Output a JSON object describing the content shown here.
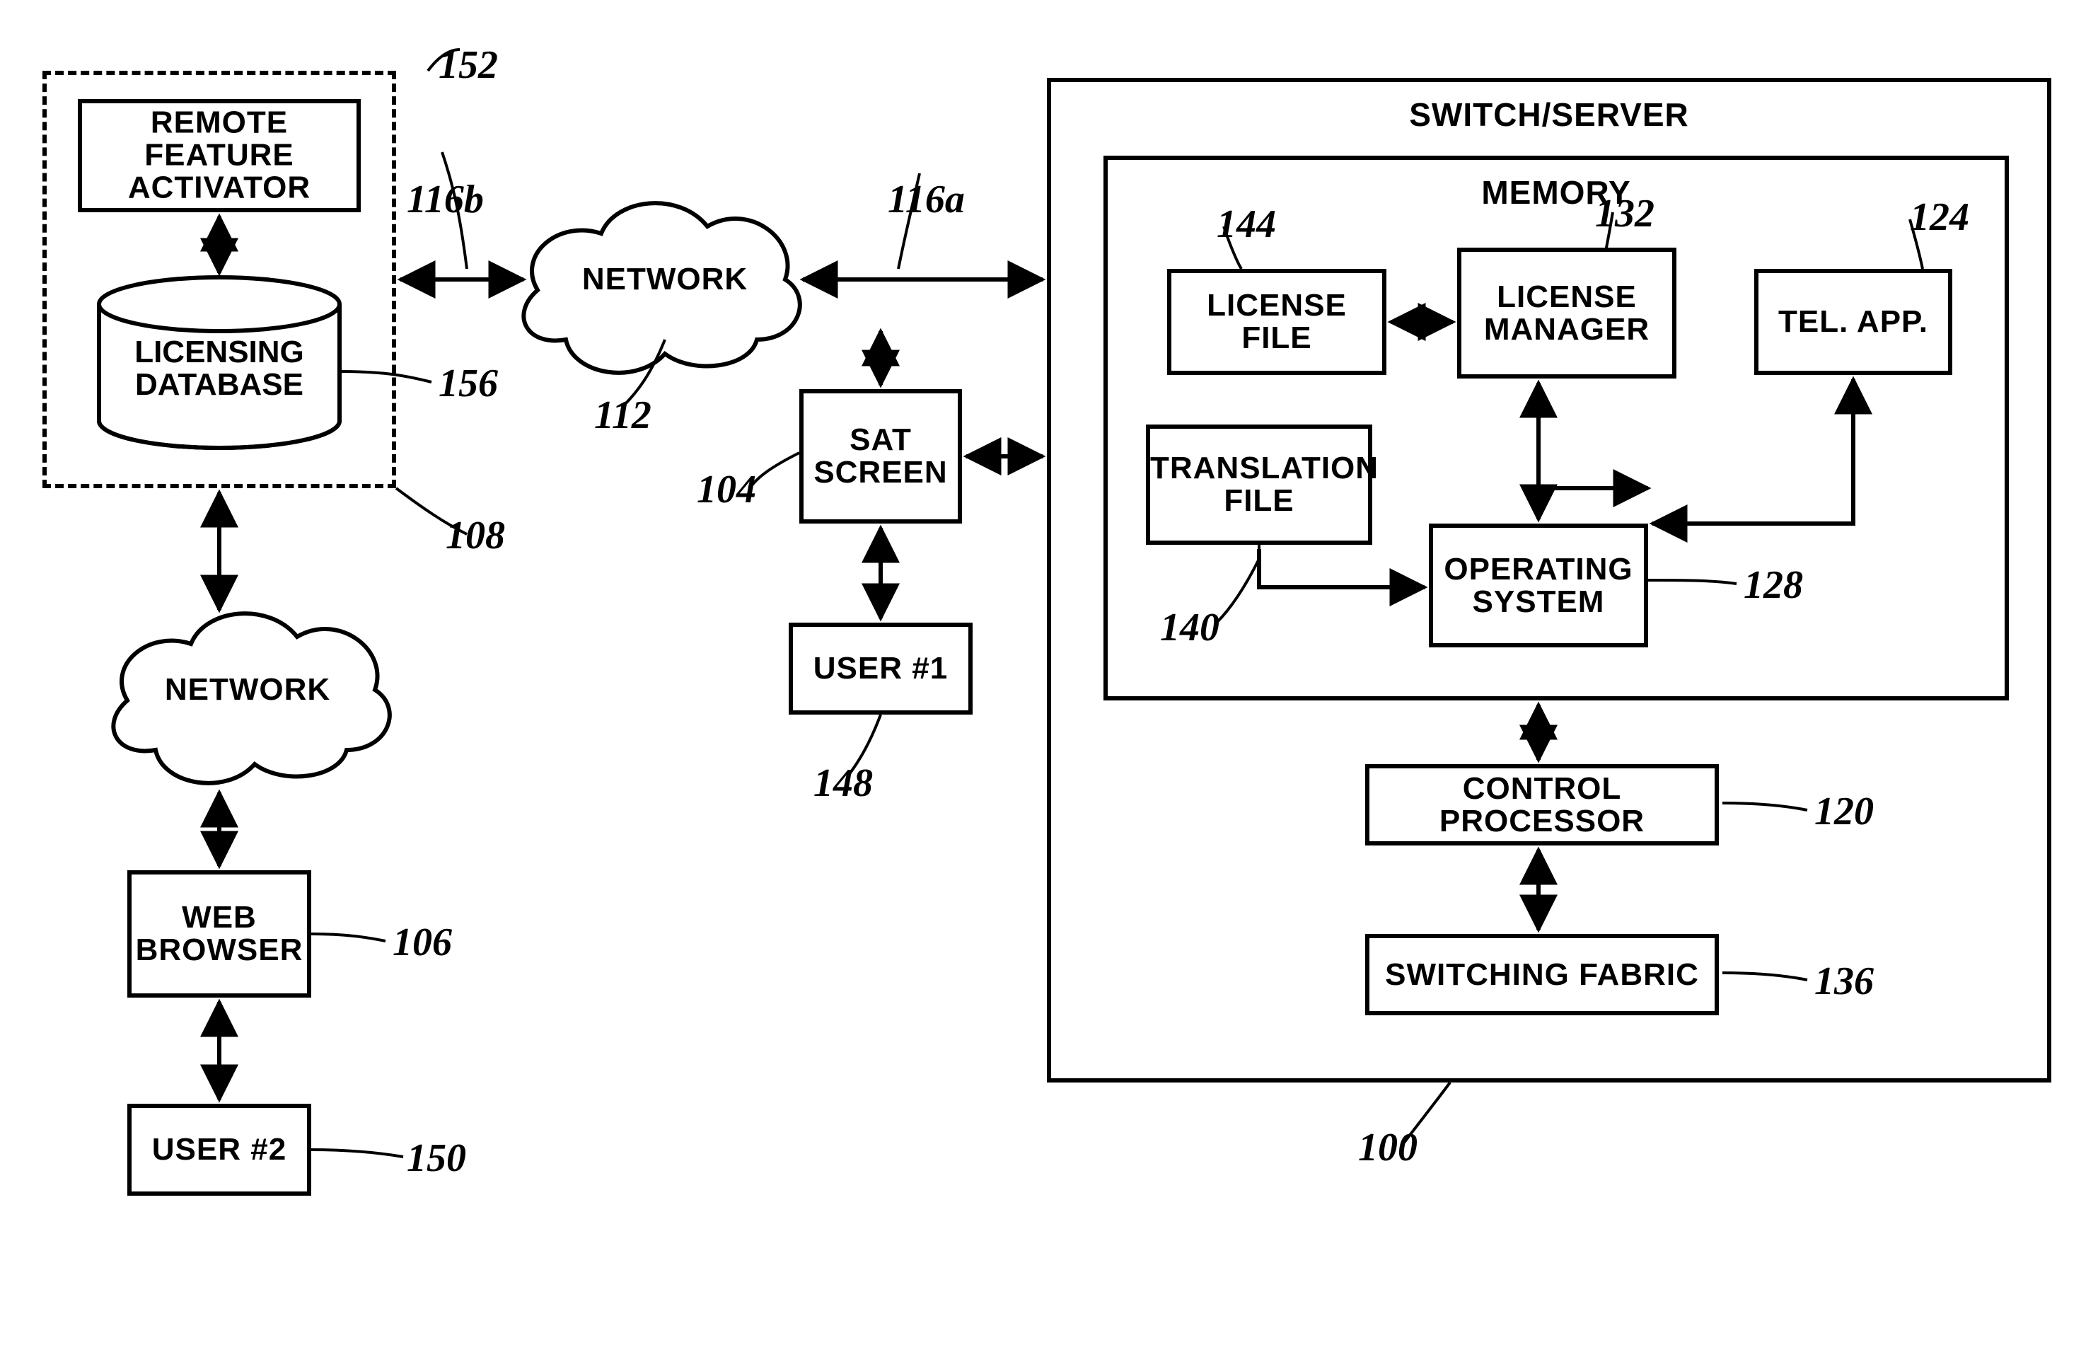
{
  "blocks": {
    "remote_feature_activator": "REMOTE FEATURE\nACTIVATOR",
    "licensing_database": "LICENSING\nDATABASE",
    "network_top": "NETWORK",
    "network_left": "NETWORK",
    "sat_screen": "SAT\nSCREEN",
    "user1": "USER #1",
    "web_browser": "WEB\nBROWSER",
    "user2": "USER #2",
    "switch_server_title": "SWITCH/SERVER",
    "memory_title": "MEMORY",
    "license_file": "LICENSE FILE",
    "license_manager": "LICENSE\nMANAGER",
    "tel_app": "TEL. APP.",
    "translation_file": "TRANSLATION\nFILE",
    "operating_system": "OPERATING\nSYSTEM",
    "control_processor": "CONTROL PROCESSOR",
    "switching_fabric": "SWITCHING FABRIC"
  },
  "refs": {
    "r152": "152",
    "r116b": "116b",
    "r116a": "116a",
    "r156": "156",
    "r112": "112",
    "r108": "108",
    "r104": "104",
    "r148": "148",
    "r144": "144",
    "r132": "132",
    "r124": "124",
    "r128": "128",
    "r140": "140",
    "r120": "120",
    "r136": "136",
    "r100": "100",
    "r106": "106",
    "r150": "150"
  }
}
